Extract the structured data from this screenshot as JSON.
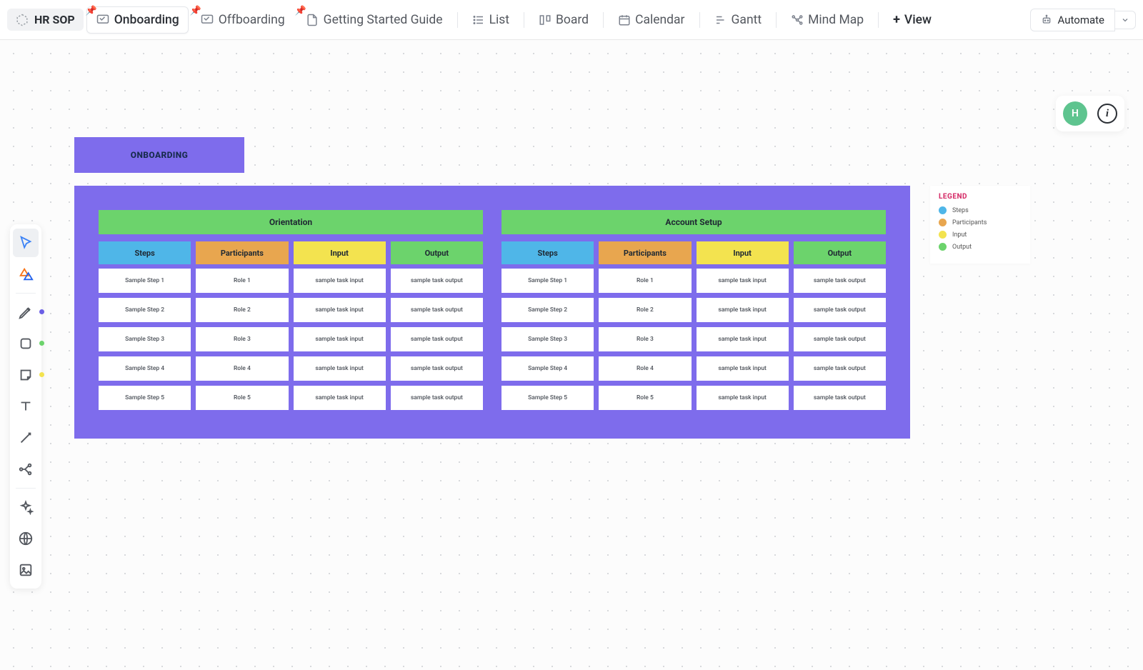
{
  "header": {
    "breadcrumb": "HR SOP",
    "tabs": [
      {
        "label": "Onboarding",
        "kind": "whiteboard",
        "pinned": true,
        "active": true
      },
      {
        "label": "Offboarding",
        "kind": "whiteboard",
        "pinned": true,
        "active": false
      },
      {
        "label": "Getting Started Guide",
        "kind": "doc",
        "pinned": true,
        "active": false
      },
      {
        "label": "List",
        "kind": "list",
        "pinned": false,
        "active": false
      },
      {
        "label": "Board",
        "kind": "board",
        "pinned": false,
        "active": false
      },
      {
        "label": "Calendar",
        "kind": "calendar",
        "pinned": false,
        "active": false
      },
      {
        "label": "Gantt",
        "kind": "gantt",
        "pinned": false,
        "active": false
      },
      {
        "label": "Mind Map",
        "kind": "mindmap",
        "pinned": false,
        "active": false
      }
    ],
    "addViewLabel": "View",
    "automateLabel": "Automate"
  },
  "corner": {
    "avatarInitial": "H"
  },
  "canvas": {
    "sectionLabel": "ONBOARDING",
    "sections": [
      {
        "title": "Orientation",
        "columns": [
          "Steps",
          "Participants",
          "Input",
          "Output"
        ],
        "rows": [
          [
            "Sample Step 1",
            "Role 1",
            "sample task input",
            "sample task output"
          ],
          [
            "Sample Step 2",
            "Role 2",
            "sample task input",
            "sample task output"
          ],
          [
            "Sample Step 3",
            "Role 3",
            "sample task input",
            "sample task output"
          ],
          [
            "Sample Step 4",
            "Role 4",
            "sample task input",
            "sample task output"
          ],
          [
            "Sample Step 5",
            "Role 5",
            "sample task input",
            "sample task output"
          ]
        ]
      },
      {
        "title": "Account Setup",
        "columns": [
          "Steps",
          "Participants",
          "Input",
          "Output"
        ],
        "rows": [
          [
            "Sample Step 1",
            "Role 1",
            "sample task input",
            "sample task output"
          ],
          [
            "Sample Step 2",
            "Role 2",
            "sample task input",
            "sample task output"
          ],
          [
            "Sample Step 3",
            "Role 3",
            "sample task input",
            "sample task output"
          ],
          [
            "Sample Step 4",
            "Role 4",
            "sample task input",
            "sample task output"
          ],
          [
            "Sample Step 5",
            "Role 5",
            "sample task input",
            "sample task output"
          ]
        ]
      }
    ],
    "legend": {
      "title": "LEGEND",
      "items": [
        {
          "label": "Steps",
          "color": "steps"
        },
        {
          "label": "Participants",
          "color": "part"
        },
        {
          "label": "Input",
          "color": "input"
        },
        {
          "label": "Output",
          "color": "output"
        }
      ]
    }
  },
  "colors": {
    "boardPurple": "#7e6cec",
    "green": "#6cd36c",
    "blue": "#4fb6e8",
    "orange": "#e8a64f",
    "yellow": "#f3e34f"
  }
}
